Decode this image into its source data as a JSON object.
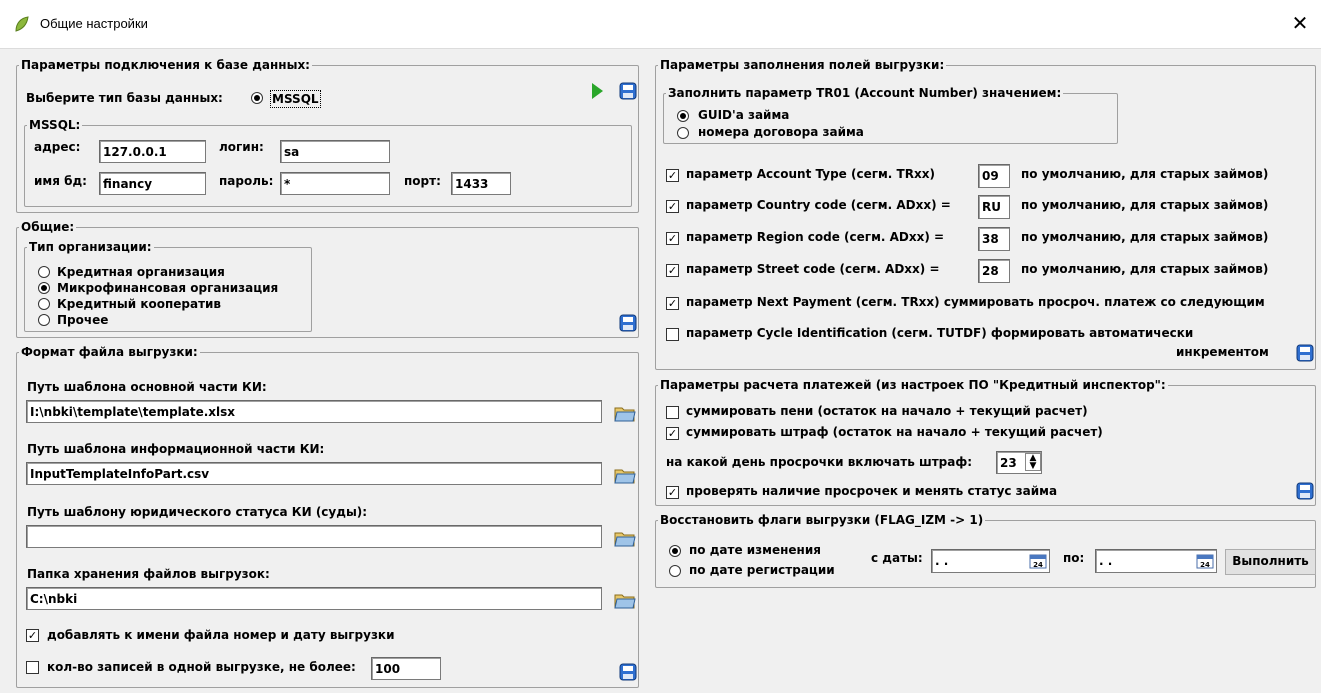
{
  "window": {
    "title": "Общие настройки"
  },
  "db": {
    "legend": "Параметры подключения к базе данных:",
    "type_label": "Выберите тип базы данных:",
    "type_option": "MSSQL",
    "sub_legend": "MSSQL:",
    "address_label": "адрес:",
    "address_value": "127.0.0.1",
    "login_label": "логин:",
    "login_value": "sa",
    "dbname_label": "имя бд:",
    "dbname_value": "financy",
    "password_label": "пароль:",
    "password_value": "*",
    "port_label": "порт:",
    "port_value": "1433"
  },
  "general": {
    "legend": "Общие:",
    "org_legend": "Тип организации:",
    "options": [
      {
        "label": "Кредитная организация",
        "selected": false
      },
      {
        "label": "Микрофинансовая организация",
        "selected": true
      },
      {
        "label": "Кредитный кооператив",
        "selected": false
      },
      {
        "label": "Прочее",
        "selected": false
      }
    ]
  },
  "export_format": {
    "legend": "Формат файла выгрузки:",
    "main_template_label": "Путь шаблона основной части КИ:",
    "main_template_value": "I:\\nbki\\template\\template.xlsx",
    "info_template_label": "Путь шаблона информационной части КИ:",
    "info_template_value": "InputTemplateInfoPart.csv",
    "legal_template_label": "Путь шаблону юридического статуса КИ (суды):",
    "legal_template_value": "",
    "folder_label": "Папка хранения файлов выгрузок:",
    "folder_value": "C:\\nbki",
    "append_label": "добавлять к имени файла номер и дату выгрузки",
    "append_checked": true,
    "limit_label": "кол-во записей в одной выгрузке, не более:",
    "limit_checked": false,
    "limit_value": "100"
  },
  "fill_params": {
    "legend": "Параметры заполнения полей выгрузки:",
    "tr01_legend": "Заполнить параметр TR01 (Account Number) значением:",
    "tr01_options": [
      {
        "label": "GUID'а займа",
        "selected": true
      },
      {
        "label": "номера договора займа",
        "selected": false
      }
    ],
    "rows": [
      {
        "label": "параметр Account Type (сегм. TRxx)",
        "value": "09",
        "suffix": "по умолчанию, для старых займов)",
        "checked": true
      },
      {
        "label": "параметр Country code (сегм. ADxx) =",
        "value": "RU",
        "suffix": "по умолчанию, для старых займов)",
        "checked": true
      },
      {
        "label": "параметр Region code (сегм. ADxx) =",
        "value": "38",
        "suffix": "по умолчанию, для старых займов)",
        "checked": true
      },
      {
        "label": "параметр Street code (сегм. ADxx) =",
        "value": "28",
        "suffix": "по умолчанию, для старых займов)",
        "checked": true
      }
    ],
    "next_payment_label": "параметр Next Payment (сегм. TRxx) суммировать просроч. платеж со следующим",
    "next_payment_checked": true,
    "cycle_label": "параметр Cycle Identification (сегм. TUTDF) формировать автоматически",
    "cycle_label_2": "инкрементом",
    "cycle_checked": false
  },
  "payments": {
    "legend": "Параметры расчета платежей (из настроек ПО \"Кредитный инспектор\":",
    "penalty_label": "суммировать пени (остаток на начало + текущий расчет)",
    "penalty_checked": false,
    "fine_label": "суммировать штраф (остаток на начало + текущий расчет)",
    "fine_checked": true,
    "fine_day_label": "на какой день просрочки включать штраф:",
    "fine_day_value": "23",
    "overdue_label": "проверять наличие просрочек и менять статус займа",
    "overdue_checked": true
  },
  "restore": {
    "legend": "Восстановить флаги выгрузки (FLAG_IZM -> 1)",
    "options": [
      {
        "label": "по дате изменения",
        "selected": true
      },
      {
        "label": "по дате регистрации",
        "selected": false
      }
    ],
    "from_label": "с даты:",
    "from_value": " .  .",
    "to_label": "по:",
    "to_value": " .  .",
    "execute_label": "Выполнить",
    "calendar_day": "24"
  },
  "icons": {
    "save": "floppy-disk-icon",
    "folder": "folder-open-icon",
    "run": "play-icon",
    "calendar": "calendar-icon"
  }
}
